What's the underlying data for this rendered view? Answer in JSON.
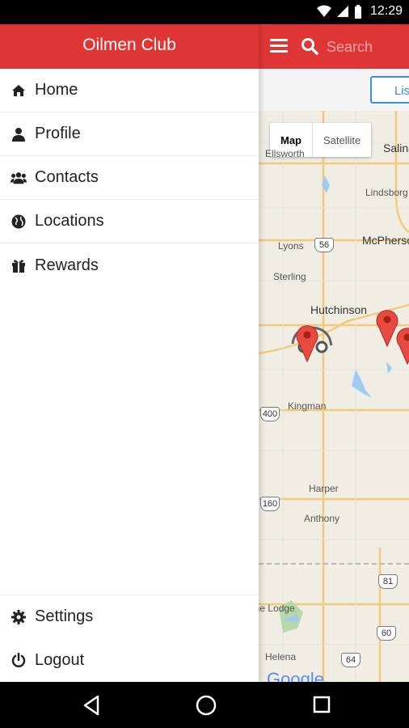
{
  "status_bar": {
    "time": "12:29"
  },
  "drawer": {
    "title": "Oilmen Club",
    "items": [
      {
        "label": "Home",
        "icon": "home-icon"
      },
      {
        "label": "Profile",
        "icon": "user-icon"
      },
      {
        "label": "Contacts",
        "icon": "users-icon"
      },
      {
        "label": "Locations",
        "icon": "globe-icon"
      },
      {
        "label": "Rewards",
        "icon": "gift-icon"
      }
    ],
    "footer_items": [
      {
        "label": "Settings",
        "icon": "gear-icon"
      },
      {
        "label": "Logout",
        "icon": "power-icon"
      }
    ]
  },
  "appbar": {
    "search_placeholder": "Search",
    "list_button": "List"
  },
  "map": {
    "toggle": {
      "map": "Map",
      "satellite": "Satellite"
    },
    "places": [
      "Salina",
      "Ellsworth",
      "Lindsborg",
      "Lyons",
      "McPherson",
      "Sterling",
      "Hutchinson",
      "Kingman",
      "Harper",
      "Anthony",
      "Medicine Lodge",
      "Helena"
    ],
    "shields": [
      "56",
      "400",
      "160",
      "81",
      "60",
      "64"
    ],
    "attribution": "Google"
  },
  "colors": {
    "primary": "#e03535",
    "accent": "#3a8ee6",
    "pin": "#e84a3f"
  }
}
